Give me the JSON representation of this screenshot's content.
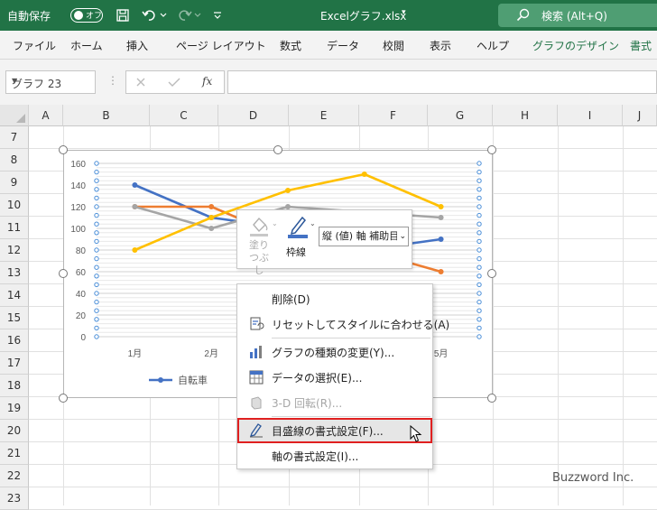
{
  "titlebar": {
    "autosave_label": "自動保存",
    "autosave_state": "オフ",
    "filename": "Excelグラフ.xlsx",
    "search_label": "検索 (Alt+Q)",
    "bg_color": "#217346"
  },
  "ribbon": {
    "tabs": [
      "ファイル",
      "ホーム",
      "挿入",
      "ページ レイアウト",
      "数式",
      "データ",
      "校閲",
      "表示",
      "ヘルプ",
      "グラフのデザイン",
      "書式"
    ]
  },
  "formulabar": {
    "namebox_value": "グラフ 23",
    "fx_label": "fx",
    "formula_value": ""
  },
  "sheet": {
    "columns": [
      "A",
      "B",
      "C",
      "D",
      "E",
      "F",
      "G",
      "H",
      "I",
      "J"
    ],
    "rows": [
      "7",
      "8",
      "9",
      "10",
      "11",
      "12",
      "13",
      "14",
      "15",
      "16",
      "17",
      "18",
      "19",
      "20",
      "21",
      "22",
      "23"
    ]
  },
  "chart_data": {
    "type": "line",
    "categories": [
      "1月",
      "2月",
      "3月",
      "4月",
      "5月"
    ],
    "ylim": [
      0,
      160
    ],
    "yticks": [
      "0",
      "20",
      "40",
      "60",
      "80",
      "100",
      "120",
      "140",
      "160"
    ],
    "grid": true,
    "legend_position": "bottom",
    "series": [
      {
        "name": "自転車",
        "color": "#4472c4",
        "values": [
          140,
          110,
          100,
          80,
          90
        ]
      },
      {
        "name": "",
        "color": "#ed7d31",
        "values": [
          120,
          120,
          90,
          80,
          60
        ]
      },
      {
        "name": "",
        "color": "#a5a5a5",
        "values": [
          120,
          100,
          120,
          115,
          110
        ]
      },
      {
        "name": "",
        "color": "#ffc000",
        "values": [
          80,
          110,
          135,
          150,
          120
        ]
      }
    ]
  },
  "minitoolbar": {
    "fill_label": "塗りつぶし",
    "line_label": "枠線",
    "element_selector": "縦 (値) 軸 補助目"
  },
  "contextmenu": {
    "items": [
      {
        "label": "削除(D)",
        "icon": "none",
        "disabled": false
      },
      {
        "label": "リセットしてスタイルに合わせる(A)",
        "icon": "reset-style-icon",
        "disabled": false
      },
      {
        "label": "グラフの種類の変更(Y)...",
        "icon": "chart-type-icon",
        "disabled": false
      },
      {
        "label": "データの選択(E)...",
        "icon": "select-data-icon",
        "disabled": false
      },
      {
        "label": "3-D 回転(R)...",
        "icon": "rotate-3d-icon",
        "disabled": true
      },
      {
        "label": "目盛線の書式設定(F)...",
        "icon": "format-gridlines-icon",
        "disabled": false,
        "highlighted": true
      },
      {
        "label": "軸の書式設定(I)...",
        "icon": "none",
        "disabled": false
      }
    ]
  },
  "watermark": "Buzzword Inc."
}
